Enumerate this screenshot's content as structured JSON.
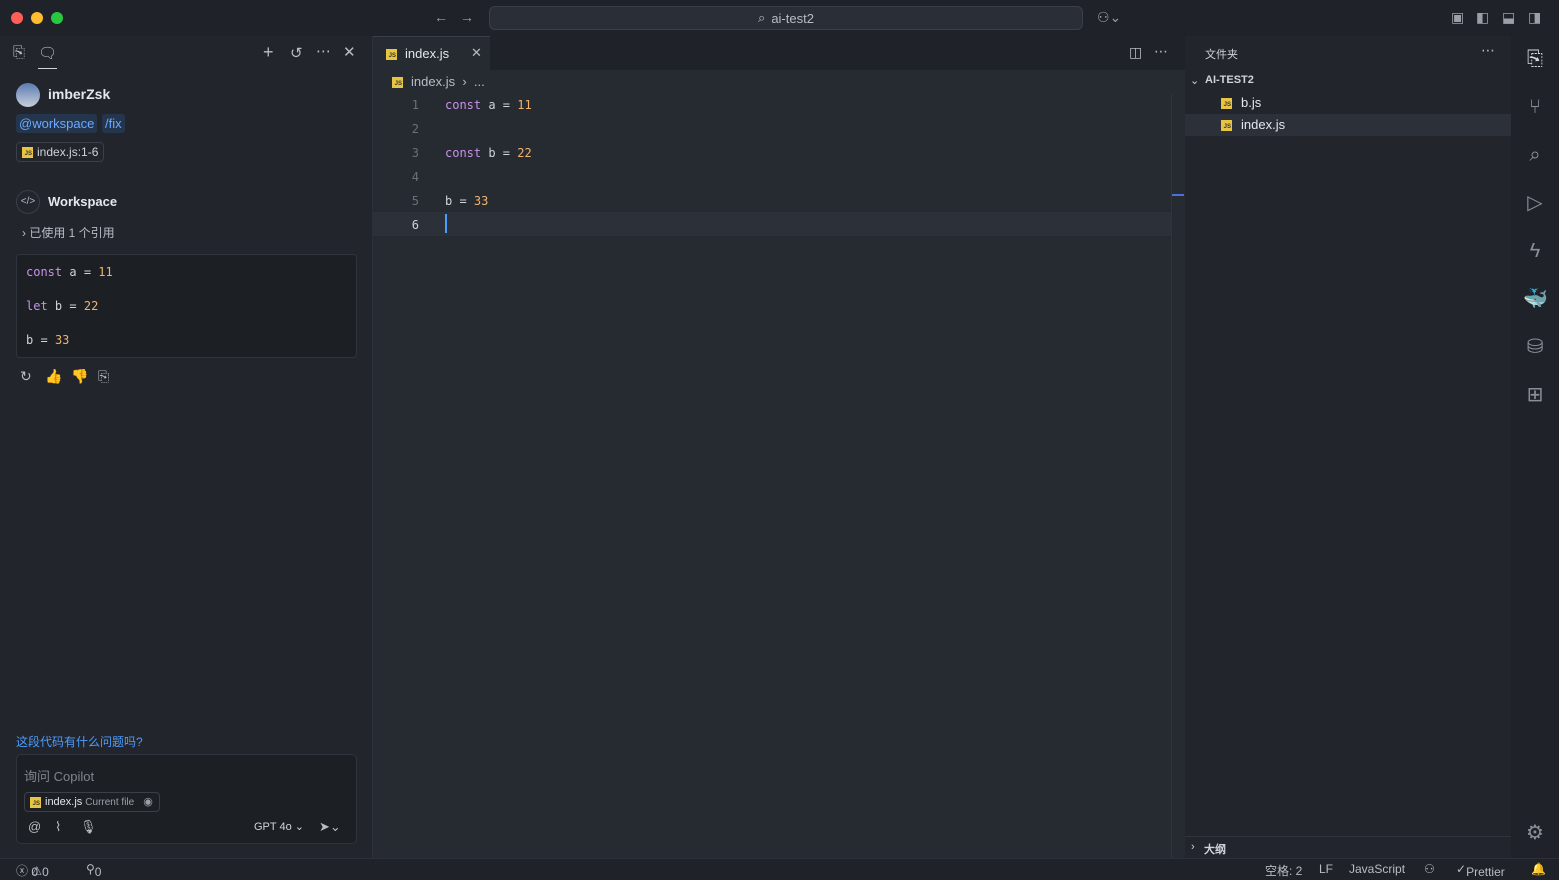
{
  "window": {
    "search_text": "ai-test2"
  },
  "chat": {
    "user": {
      "name": "imberZsk"
    },
    "chips": [
      "@workspace",
      "/fix"
    ],
    "reference_chip": "index.js:1-6",
    "response": {
      "agent_name": "Workspace",
      "references_label": "已使用 1 个引用",
      "code_lines": [
        {
          "keyword": "const",
          "ident": "a",
          "op": "=",
          "value": "11"
        },
        {
          "keyword": "let",
          "ident": "b",
          "op": "=",
          "value": "22"
        },
        {
          "keyword": "",
          "ident": "b",
          "op": "=",
          "value": "33"
        }
      ]
    },
    "suggestion": "这段代码有什么问题吗?",
    "input": {
      "placeholder": "询问 Copilot",
      "file_chip_name": "index.js",
      "file_chip_sub": "Current file",
      "model": "GPT 4o"
    }
  },
  "editor": {
    "tab_label": "index.js",
    "breadcrumb_file": "index.js",
    "breadcrumb_more": "...",
    "lines": [
      {
        "num": "1",
        "tokens": [
          [
            "kw",
            "const"
          ],
          [
            "op",
            " a = "
          ],
          [
            "num",
            "11"
          ]
        ]
      },
      {
        "num": "2",
        "tokens": []
      },
      {
        "num": "3",
        "tokens": [
          [
            "kw",
            "const"
          ],
          [
            "op",
            " b = "
          ],
          [
            "num",
            "22"
          ]
        ]
      },
      {
        "num": "4",
        "tokens": []
      },
      {
        "num": "5",
        "tokens": [
          [
            "op",
            "b = "
          ],
          [
            "num",
            "33"
          ]
        ]
      },
      {
        "num": "6",
        "tokens": []
      }
    ]
  },
  "explorer": {
    "title": "文件夹",
    "project": "AI-TEST2",
    "files": [
      "b.js",
      "index.js"
    ],
    "outline": "大纲"
  },
  "status": {
    "errors": "0",
    "warnings": "0",
    "ports": "0",
    "indent": "空格: 2",
    "eol": "LF",
    "language": "JavaScript",
    "formatter": "Prettier"
  },
  "colors": {
    "accent": "#4d9cff",
    "keyword": "#c792ea",
    "number": "#f2b36c",
    "js_badge": "#e8c441"
  }
}
